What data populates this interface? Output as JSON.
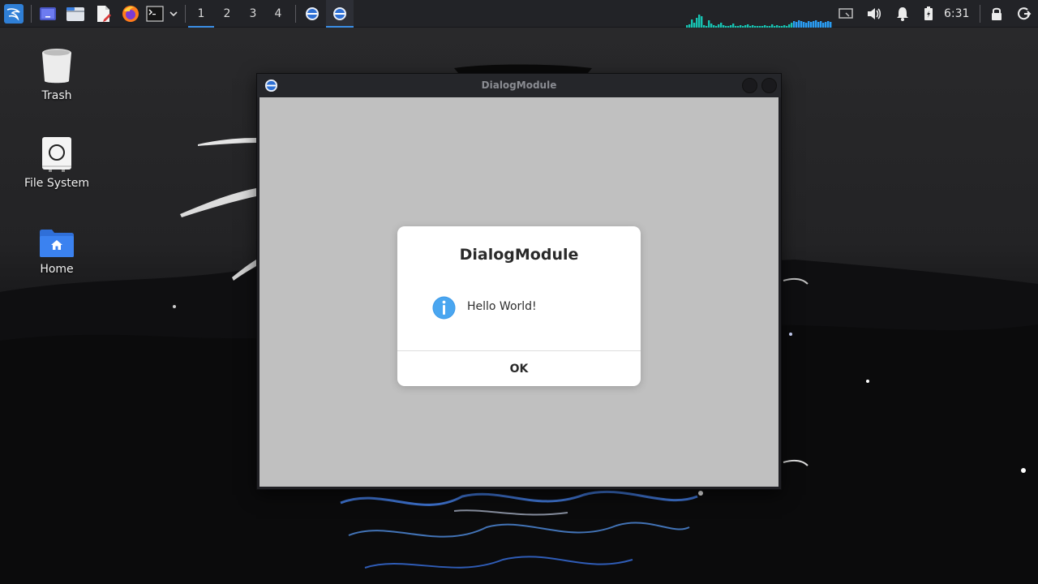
{
  "panel": {
    "launchers": [
      {
        "name": "kali-menu-icon"
      },
      {
        "name": "show-desktop-icon"
      },
      {
        "name": "file-manager-icon"
      },
      {
        "name": "text-editor-icon"
      },
      {
        "name": "firefox-icon"
      },
      {
        "name": "terminal-icon"
      }
    ],
    "workspaces": [
      "1",
      "2",
      "3",
      "4"
    ],
    "active_workspace": "1",
    "clock": "6:31",
    "accent": "#3a8ee6",
    "graph_color": "#17c3b2"
  },
  "desktop": {
    "icons": [
      {
        "label": "Trash",
        "icon": "trash-icon"
      },
      {
        "label": "File System",
        "icon": "drive-icon"
      },
      {
        "label": "Home",
        "icon": "home-folder-icon"
      }
    ]
  },
  "window": {
    "title": "DialogModule",
    "client_bg": "#c0c0c0"
  },
  "dialog": {
    "title": "DialogModule",
    "message": "Hello World!",
    "ok_label": "OK",
    "icon": "info-icon",
    "icon_color": "#3d9ae8"
  }
}
